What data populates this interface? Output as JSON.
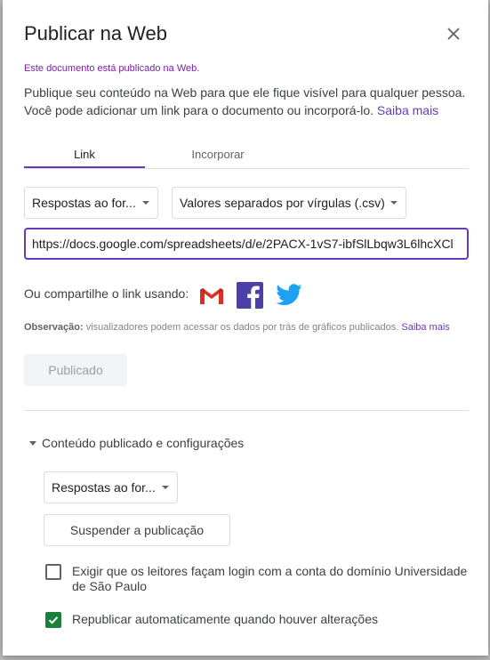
{
  "dialog": {
    "title": "Publicar na Web",
    "status": "Este documento está publicado na Web.",
    "description": "Publique seu conteúdo na Web para que ele fique visível para qualquer pessoa. Você pode adicionar um link para o documento ou incorporá-lo.",
    "learn_more": "Saiba mais",
    "close_icon": "close-icon"
  },
  "tabs": [
    {
      "label": "Link",
      "active": true
    },
    {
      "label": "Incorporar",
      "active": false
    }
  ],
  "selects": {
    "sheet": "Respostas ao for...",
    "format": "Valores separados por vírgulas (.csv)"
  },
  "url": {
    "value": "https://docs.google.com/spreadsheets/d/e/2PACX-1vS7-ibfSlLbqw3L6lhcXCl"
  },
  "share": {
    "label": "Ou compartilhe o link usando:",
    "icons": [
      "gmail-icon",
      "facebook-icon",
      "twitter-icon"
    ]
  },
  "note": {
    "prefix": "Observação:",
    "text": " visualizadores podem acessar os dados por trás de gráficos publicados.",
    "link": "Saiba mais"
  },
  "published_button": "Publicado",
  "settings": {
    "section_label": "Conteúdo publicado e configurações",
    "sheet": "Respostas ao for...",
    "stop_button": "Suspender a publicação",
    "require_login": {
      "label": "Exigir que os leitores façam login com a conta do domínio Universidade de São Paulo",
      "checked": false
    },
    "auto_republish": {
      "label": "Republicar automaticamente quando houver alterações",
      "checked": true
    }
  },
  "colors": {
    "accent": "#673ab7",
    "status": "#7b1fa2",
    "checkbox": "#188038"
  }
}
